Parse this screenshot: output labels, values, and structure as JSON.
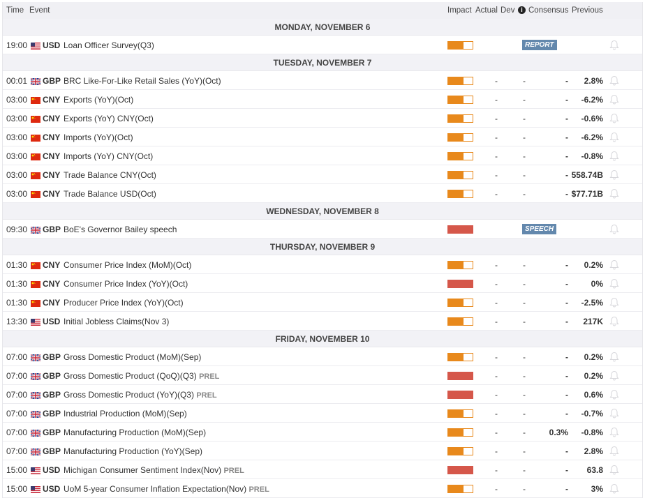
{
  "header": {
    "time": "Time",
    "event": "Event",
    "impact": "Impact",
    "actual": "Actual",
    "dev": "Dev",
    "info": "i",
    "consensus": "Consensus",
    "previous": "Previous"
  },
  "colors": {
    "medium": "#e8891c",
    "high": "#d5574a",
    "badge": "#6388ad"
  },
  "days": [
    {
      "label": "MONDAY, NOVEMBER 6",
      "rows": [
        {
          "time": "19:00",
          "cur": "USD",
          "event": "Loan Officer Survey(Q3)",
          "impact": "med",
          "badge": "REPORT"
        }
      ]
    },
    {
      "label": "TUESDAY, NOVEMBER 7",
      "rows": [
        {
          "time": "00:01",
          "cur": "GBP",
          "event": "BRC Like-For-Like Retail Sales (YoY)(Oct)",
          "impact": "med",
          "actual": "-",
          "dev": "-",
          "consensus": "-",
          "previous": "2.8%"
        },
        {
          "time": "03:00",
          "cur": "CNY",
          "event": "Exports (YoY)(Oct)",
          "impact": "med",
          "actual": "-",
          "dev": "-",
          "consensus": "-",
          "previous": "-6.2%"
        },
        {
          "time": "03:00",
          "cur": "CNY",
          "event": "Exports (YoY) CNY(Oct)",
          "impact": "med",
          "actual": "-",
          "dev": "-",
          "consensus": "-",
          "previous": "-0.6%"
        },
        {
          "time": "03:00",
          "cur": "CNY",
          "event": "Imports (YoY)(Oct)",
          "impact": "med",
          "actual": "-",
          "dev": "-",
          "consensus": "-",
          "previous": "-6.2%"
        },
        {
          "time": "03:00",
          "cur": "CNY",
          "event": "Imports (YoY) CNY(Oct)",
          "impact": "med",
          "actual": "-",
          "dev": "-",
          "consensus": "-",
          "previous": "-0.8%"
        },
        {
          "time": "03:00",
          "cur": "CNY",
          "event": "Trade Balance CNY(Oct)",
          "impact": "med",
          "actual": "-",
          "dev": "-",
          "consensus": "-",
          "previous": "558.74B"
        },
        {
          "time": "03:00",
          "cur": "CNY",
          "event": "Trade Balance USD(Oct)",
          "impact": "med",
          "actual": "-",
          "dev": "-",
          "consensus": "-",
          "previous": "$77.71B"
        }
      ]
    },
    {
      "label": "WEDNESDAY, NOVEMBER 8",
      "rows": [
        {
          "time": "09:30",
          "cur": "GBP",
          "event": "BoE's Governor Bailey speech",
          "impact": "high",
          "badge": "SPEECH"
        }
      ]
    },
    {
      "label": "THURSDAY, NOVEMBER 9",
      "rows": [
        {
          "time": "01:30",
          "cur": "CNY",
          "event": "Consumer Price Index (MoM)(Oct)",
          "impact": "med",
          "actual": "-",
          "dev": "-",
          "consensus": "-",
          "previous": "0.2%"
        },
        {
          "time": "01:30",
          "cur": "CNY",
          "event": "Consumer Price Index (YoY)(Oct)",
          "impact": "high",
          "actual": "-",
          "dev": "-",
          "consensus": "-",
          "previous": "0%"
        },
        {
          "time": "01:30",
          "cur": "CNY",
          "event": "Producer Price Index (YoY)(Oct)",
          "impact": "med",
          "actual": "-",
          "dev": "-",
          "consensus": "-",
          "previous": "-2.5%"
        },
        {
          "time": "13:30",
          "cur": "USD",
          "event": "Initial Jobless Claims(Nov 3)",
          "impact": "med",
          "actual": "-",
          "dev": "-",
          "consensus": "-",
          "previous": "217K"
        }
      ]
    },
    {
      "label": "FRIDAY, NOVEMBER 10",
      "rows": [
        {
          "time": "07:00",
          "cur": "GBP",
          "event": "Gross Domestic Product (MoM)(Sep)",
          "impact": "med",
          "actual": "-",
          "dev": "-",
          "consensus": "-",
          "previous": "0.2%"
        },
        {
          "time": "07:00",
          "cur": "GBP",
          "event": "Gross Domestic Product (QoQ)(Q3)",
          "prel": "PREL",
          "impact": "high",
          "actual": "-",
          "dev": "-",
          "consensus": "-",
          "previous": "0.2%"
        },
        {
          "time": "07:00",
          "cur": "GBP",
          "event": "Gross Domestic Product (YoY)(Q3)",
          "prel": "PREL",
          "impact": "high",
          "actual": "-",
          "dev": "-",
          "consensus": "-",
          "previous": "0.6%"
        },
        {
          "time": "07:00",
          "cur": "GBP",
          "event": "Industrial Production (MoM)(Sep)",
          "impact": "med",
          "actual": "-",
          "dev": "-",
          "consensus": "-",
          "previous": "-0.7%"
        },
        {
          "time": "07:00",
          "cur": "GBP",
          "event": "Manufacturing Production (MoM)(Sep)",
          "impact": "med",
          "actual": "-",
          "dev": "-",
          "consensus": "0.3%",
          "previous": "-0.8%"
        },
        {
          "time": "07:00",
          "cur": "GBP",
          "event": "Manufacturing Production (YoY)(Sep)",
          "impact": "med",
          "actual": "-",
          "dev": "-",
          "consensus": "-",
          "previous": "2.8%"
        },
        {
          "time": "15:00",
          "cur": "USD",
          "event": "Michigan Consumer Sentiment Index(Nov)",
          "prel": "PREL",
          "impact": "high",
          "actual": "-",
          "dev": "-",
          "consensus": "-",
          "previous": "63.8"
        },
        {
          "time": "15:00",
          "cur": "USD",
          "event": "UoM 5-year Consumer Inflation Expectation(Nov)",
          "prel": "PREL",
          "impact": "med",
          "actual": "-",
          "dev": "-",
          "consensus": "-",
          "previous": "3%"
        }
      ]
    }
  ]
}
